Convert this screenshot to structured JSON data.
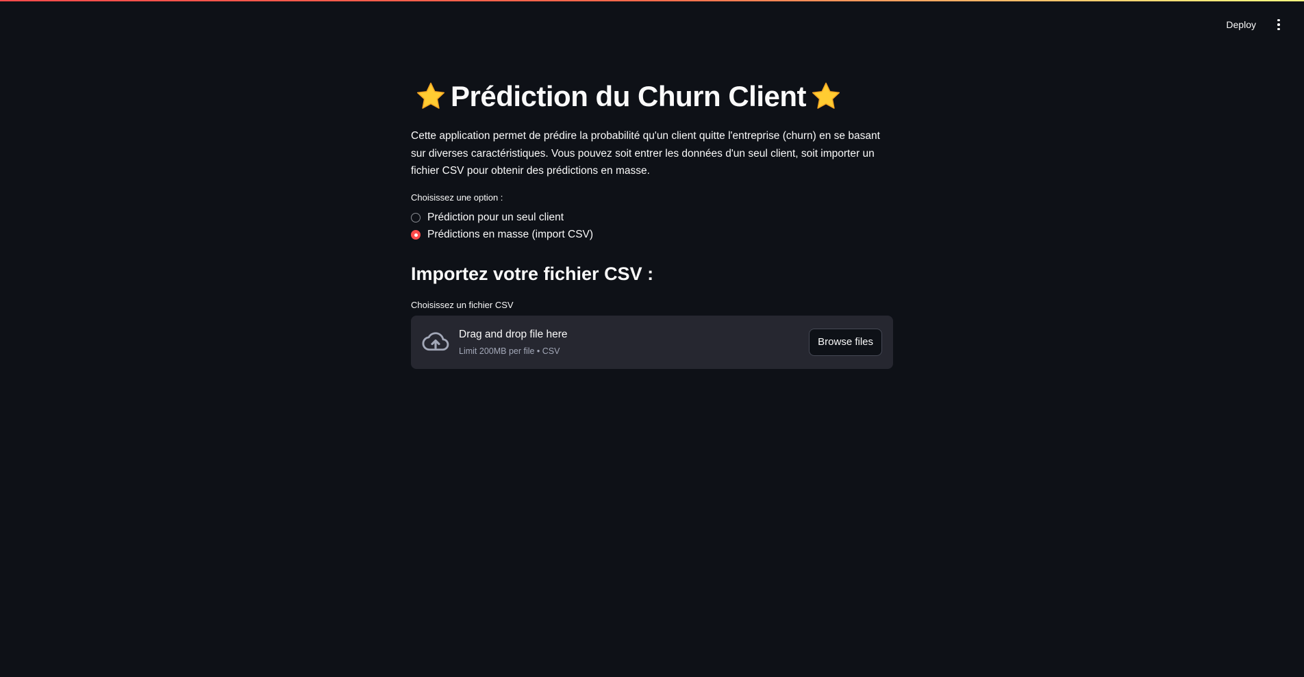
{
  "header": {
    "deploy_label": "Deploy"
  },
  "main": {
    "title": "Prédiction du Churn Client",
    "description": "Cette application permet de prédire la probabilité qu'un client quitte l'entreprise (churn) en se basant sur diverses caractéristiques. Vous pouvez soit entrer les données d'un seul client, soit importer un fichier CSV pour obtenir des prédictions en masse.",
    "radio": {
      "label": "Choisissez une option :",
      "options": [
        {
          "label": "Prédiction pour un seul client",
          "selected": false
        },
        {
          "label": "Prédictions en masse (import CSV)",
          "selected": true
        }
      ]
    },
    "upload_section": {
      "heading": "Importez votre fichier CSV :",
      "uploader_label": "Choisissez un fichier CSV",
      "dropzone_text": "Drag and drop file here",
      "dropzone_limit": "Limit 200MB per file • CSV",
      "browse_label": "Browse files"
    }
  },
  "icons": {
    "title_star": "star-icon",
    "upload": "cloud-upload-icon",
    "menu": "more-vertical-icon"
  },
  "colors": {
    "background": "#0e1117",
    "accent": "#ff4b4b",
    "dropzone_bg": "#262730",
    "star": "#ffcc32"
  }
}
